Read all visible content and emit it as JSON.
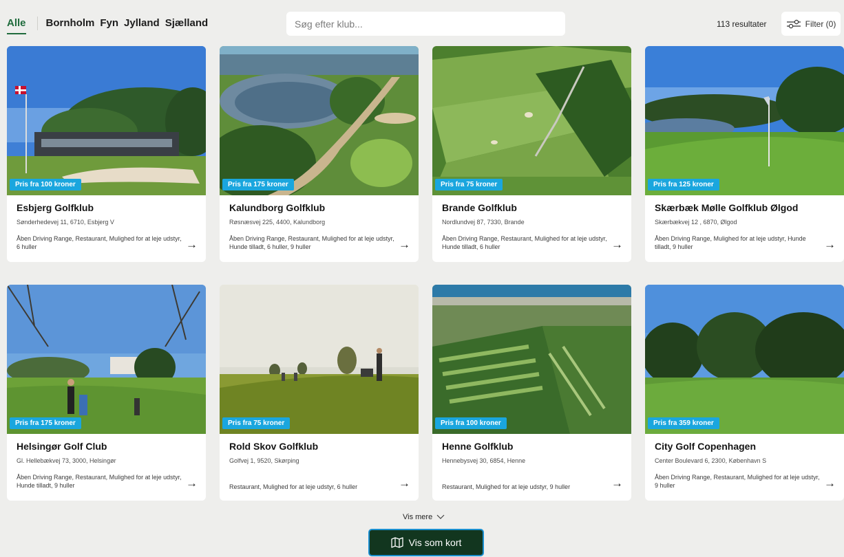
{
  "regions": [
    {
      "label": "Alle",
      "active": true
    },
    {
      "label": "Bornholm",
      "active": false
    },
    {
      "label": "Fyn",
      "active": false
    },
    {
      "label": "Jylland",
      "active": false
    },
    {
      "label": "Sjælland",
      "active": false
    }
  ],
  "search": {
    "placeholder": "Søg efter klub..."
  },
  "results_count": "113 resultater",
  "filter": {
    "label": "Filter (0)",
    "icon": "sliders-icon"
  },
  "cards": [
    {
      "name": "Esbjerg Golfklub",
      "address": "Sønderhedevej 11, 6710, Esbjerg V",
      "features": "Åben Driving Range, Restaurant, Mulighed for at leje udstyr, 6 huller",
      "price": "Pris fra 100 kroner",
      "scene": "clubhouse-flag"
    },
    {
      "name": "Kalundborg Golfklub",
      "address": "Røsnæsvej 225, 4400, Kalundborg",
      "features": "Åben Driving Range, Restaurant, Mulighed for at leje udstyr, Hunde tilladt, 6 huller, 9 huller",
      "price": "Pris fra 175 kroner",
      "scene": "lake-path"
    },
    {
      "name": "Brande Golfklub",
      "address": "Nordlundvej 87, 7330, Brande",
      "features": "Åben Driving Range, Restaurant, Mulighed for at leje udstyr, Hunde tilladt, 6 huller",
      "price": "Pris fra 75 kroner",
      "scene": "aerial-fairways"
    },
    {
      "name": "Skærbæk Mølle Golfklub Ølgod",
      "address": "Skærbækvej 12 , 6870, Ølgod",
      "features": "Åben Driving Range, Mulighed for at leje udstyr, Hunde tilladt, 9 huller",
      "price": "Pris fra 125 kroner",
      "scene": "pond-flag"
    },
    {
      "name": "Helsingør Golf Club",
      "address": "Gl. Hellebækvej 73, 3000, Helsingør",
      "features": "Åben Driving Range, Restaurant, Mulighed for at leje udstyr, Hunde tilladt, 9 huller",
      "price": "Pris fra 175 kroner",
      "scene": "players-manor"
    },
    {
      "name": "Rold Skov Golfklub",
      "address": "Golfvej 1, 9520, Skørping",
      "features": "Restaurant, Mulighed for at leje udstyr, 6 huller",
      "price": "Pris fra 75 kroner",
      "scene": "sunset-players"
    },
    {
      "name": "Henne Golfklub",
      "address": "Hennebysvej 30, 6854, Henne",
      "features": "Restaurant, Mulighed for at leje udstyr, 9 huller",
      "price": "Pris fra 100 kroner",
      "scene": "aerial-coast"
    },
    {
      "name": "City Golf Copenhagen",
      "address": "Center Boulevard 6, 2300, København S",
      "features": "Åben Driving Range, Restaurant, Mulighed for at leje udstyr, 9 huller",
      "price": "Pris fra 359 kroner",
      "scene": "treeline-green"
    }
  ],
  "vis_mere": "Vis mere",
  "map_button": {
    "label": "Vis som kort",
    "icon": "map-icon"
  },
  "colors": {
    "accent_green": "#1f6b3c",
    "badge_blue": "#1aa6de",
    "map_button_bg": "#12361f"
  }
}
